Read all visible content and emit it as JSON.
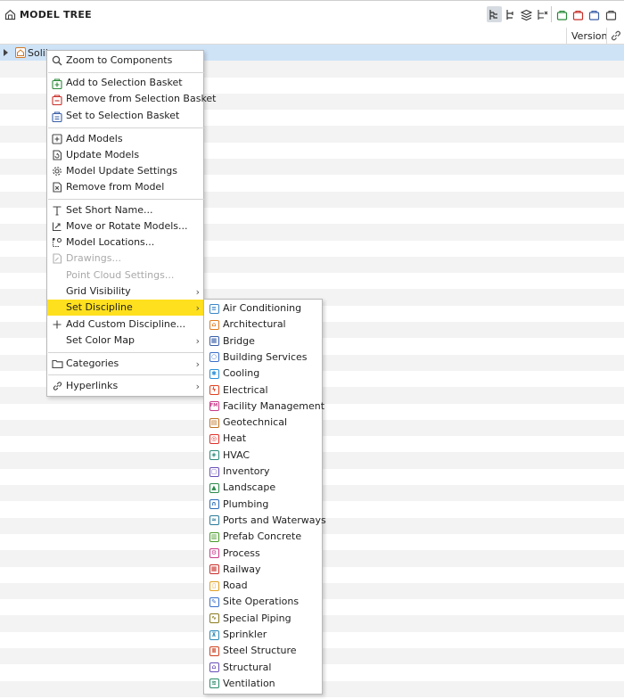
{
  "header": {
    "title": "MODEL TREE"
  },
  "columns": {
    "version": "Version"
  },
  "tree": {
    "root_label": "Solib"
  },
  "context_menu": {
    "items": [
      {
        "label": "Zoom to Components",
        "icon": "zoom-icon",
        "disabled": false
      },
      {
        "label": "Add to Selection Basket",
        "icon": "basket-add-icon",
        "disabled": false
      },
      {
        "label": "Remove from Selection Basket",
        "icon": "basket-remove-icon",
        "disabled": false
      },
      {
        "label": "Set to Selection Basket",
        "icon": "basket-set-icon",
        "disabled": false
      },
      {
        "label": "Add Models",
        "icon": "add-model-icon",
        "disabled": false
      },
      {
        "label": "Update Models",
        "icon": "update-model-icon",
        "disabled": false
      },
      {
        "label": "Model Update Settings",
        "icon": "gear-icon",
        "disabled": false
      },
      {
        "label": "Remove from Model",
        "icon": "remove-model-icon",
        "disabled": false
      },
      {
        "label": "Set Short Name...",
        "icon": "text-icon",
        "disabled": false
      },
      {
        "label": "Move or Rotate Models...",
        "icon": "move-icon",
        "disabled": false
      },
      {
        "label": "Model Locations...",
        "icon": "location-icon",
        "disabled": false
      },
      {
        "label": "Drawings...",
        "icon": "drawing-icon",
        "disabled": true
      },
      {
        "label": "Point Cloud Settings...",
        "icon": "",
        "disabled": true
      },
      {
        "label": "Grid Visibility",
        "icon": "",
        "disabled": false,
        "submenu": true
      },
      {
        "label": "Set Discipline",
        "icon": "",
        "disabled": false,
        "submenu": true,
        "highlighted": true
      },
      {
        "label": "Add Custom Discipline...",
        "icon": "plus-icon",
        "disabled": false
      },
      {
        "label": "Set Color Map",
        "icon": "",
        "disabled": false,
        "submenu": true
      },
      {
        "label": "Categories",
        "icon": "folder-icon",
        "disabled": false,
        "submenu": true
      },
      {
        "label": "Hyperlinks",
        "icon": "link-icon",
        "disabled": false,
        "submenu": true
      }
    ]
  },
  "discipline_menu": {
    "items": [
      {
        "label": "Air Conditioning",
        "icon": "air-conditioning-icon",
        "color": "#3a86c8",
        "glyph": "≡"
      },
      {
        "label": "Architectural",
        "icon": "architectural-icon",
        "color": "#e07b1f",
        "glyph": "⌂"
      },
      {
        "label": "Bridge",
        "icon": "bridge-icon",
        "color": "#3a5fa8",
        "glyph": "▦"
      },
      {
        "label": "Building Services",
        "icon": "building-services-icon",
        "color": "#3a6fc8",
        "glyph": "○"
      },
      {
        "label": "Cooling",
        "icon": "cooling-icon",
        "color": "#2a8fd8",
        "glyph": "✱"
      },
      {
        "label": "Electrical",
        "icon": "electrical-icon",
        "color": "#e0401f",
        "glyph": "ϟ"
      },
      {
        "label": "Facility Management",
        "icon": "facility-management-icon",
        "color": "#c83a8a",
        "glyph": "FM"
      },
      {
        "label": "Geotechnical",
        "icon": "geotechnical-icon",
        "color": "#c0701f",
        "glyph": "▤"
      },
      {
        "label": "Heat",
        "icon": "heat-icon",
        "color": "#e0302a",
        "glyph": "◎"
      },
      {
        "label": "HVAC",
        "icon": "hvac-icon",
        "color": "#2a8a7a",
        "glyph": "◈"
      },
      {
        "label": "Inventory",
        "icon": "inventory-icon",
        "color": "#6a4fb8",
        "glyph": "▢"
      },
      {
        "label": "Landscape",
        "icon": "landscape-icon",
        "color": "#2a8a4a",
        "glyph": "▲"
      },
      {
        "label": "Plumbing",
        "icon": "plumbing-icon",
        "color": "#2a6ab8",
        "glyph": "∩"
      },
      {
        "label": "Ports and Waterways",
        "icon": "ports-waterways-icon",
        "color": "#2a7a9a",
        "glyph": "≈"
      },
      {
        "label": "Prefab Concrete",
        "icon": "prefab-concrete-icon",
        "color": "#4a9a2a",
        "glyph": "▥"
      },
      {
        "label": "Process",
        "icon": "process-icon",
        "color": "#c83a8a",
        "glyph": "⚙"
      },
      {
        "label": "Railway",
        "icon": "railway-icon",
        "color": "#c8302a",
        "glyph": "▦"
      },
      {
        "label": "Road",
        "icon": "road-icon",
        "color": "#e0a01f",
        "glyph": "▯"
      },
      {
        "label": "Site Operations",
        "icon": "site-operations-icon",
        "color": "#3a6fc8",
        "glyph": "✎"
      },
      {
        "label": "Special Piping",
        "icon": "special-piping-icon",
        "color": "#8a7a1f",
        "glyph": "∿"
      },
      {
        "label": "Sprinkler",
        "icon": "sprinkler-icon",
        "color": "#2a8ab8",
        "glyph": "⊼"
      },
      {
        "label": "Steel Structure",
        "icon": "steel-structure-icon",
        "color": "#d0401f",
        "glyph": "Ⅱ"
      },
      {
        "label": "Structural",
        "icon": "structural-icon",
        "color": "#6a4fb8",
        "glyph": "⌂"
      },
      {
        "label": "Ventilation",
        "icon": "ventilation-icon",
        "color": "#2a8a6a",
        "glyph": "≋"
      }
    ]
  },
  "colors": {
    "highlight": "#ffe01f",
    "selected_row": "#cfe3f7"
  }
}
